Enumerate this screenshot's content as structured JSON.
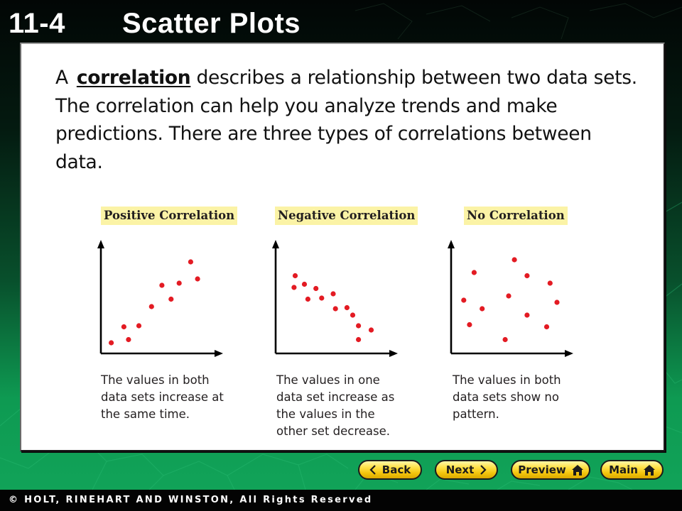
{
  "slide": {
    "lesson_number": "11-4",
    "title": "Scatter Plots"
  },
  "intro": {
    "prefix": "A",
    "term": "correlation",
    "text": " describes a relationship between two data sets. The correlation can help you analyze trends and make predictions. There are three types of correlations between data."
  },
  "correlations": [
    {
      "label": "Positive Correlation",
      "description_lines": [
        "The values in both",
        "data sets increase at",
        "the same time."
      ]
    },
    {
      "label": "Negative Correlation",
      "description_lines": [
        "The values in one",
        "data set increase as",
        "the values in the",
        "other set decrease."
      ]
    },
    {
      "label": "No Correlation",
      "description_lines": [
        "The values in both",
        "data sets show no",
        "pattern."
      ]
    }
  ],
  "navigation": {
    "back_label": "Back",
    "next_label": "Next",
    "preview_label": "Preview",
    "main_label": "Main"
  },
  "footer": {
    "copyright": "© HOLT, RINEHART AND WINSTON, All Rights Reserved"
  },
  "colors": {
    "dot": "#e31b23",
    "label_highlight": "#fbf3a6",
    "button_yellow": "#f6cf1c"
  },
  "chart_data": [
    {
      "type": "scatter",
      "title": "Positive Correlation",
      "xlabel": "",
      "ylabel": "",
      "xlim": [
        0,
        10
      ],
      "ylim": [
        0,
        10
      ],
      "grid": false,
      "points": [
        {
          "x": 0.9,
          "y": 1.0
        },
        {
          "x": 2.0,
          "y": 2.5
        },
        {
          "x": 2.4,
          "y": 1.3
        },
        {
          "x": 3.3,
          "y": 2.6
        },
        {
          "x": 4.4,
          "y": 4.4
        },
        {
          "x": 5.3,
          "y": 6.4
        },
        {
          "x": 6.1,
          "y": 5.1
        },
        {
          "x": 6.8,
          "y": 6.6
        },
        {
          "x": 7.8,
          "y": 8.6
        },
        {
          "x": 8.4,
          "y": 7.0
        }
      ]
    },
    {
      "type": "scatter",
      "title": "Negative Correlation",
      "xlabel": "",
      "ylabel": "",
      "xlim": [
        0,
        10
      ],
      "ylim": [
        0,
        10
      ],
      "grid": false,
      "points": [
        {
          "x": 1.7,
          "y": 7.3
        },
        {
          "x": 1.6,
          "y": 6.2
        },
        {
          "x": 2.5,
          "y": 6.5
        },
        {
          "x": 2.8,
          "y": 5.1
        },
        {
          "x": 3.5,
          "y": 6.1
        },
        {
          "x": 4.0,
          "y": 5.2
        },
        {
          "x": 5.0,
          "y": 5.6
        },
        {
          "x": 5.2,
          "y": 4.2
        },
        {
          "x": 6.2,
          "y": 4.3
        },
        {
          "x": 6.7,
          "y": 3.6
        },
        {
          "x": 7.2,
          "y": 2.6
        },
        {
          "x": 8.3,
          "y": 2.2
        },
        {
          "x": 7.2,
          "y": 1.3
        }
      ]
    },
    {
      "type": "scatter",
      "title": "No Correlation",
      "xlabel": "",
      "ylabel": "",
      "xlim": [
        0,
        10
      ],
      "ylim": [
        0,
        10
      ],
      "grid": false,
      "points": [
        {
          "x": 1.1,
          "y": 5.0
        },
        {
          "x": 1.6,
          "y": 2.7
        },
        {
          "x": 2.0,
          "y": 7.6
        },
        {
          "x": 2.7,
          "y": 4.2
        },
        {
          "x": 4.7,
          "y": 1.3
        },
        {
          "x": 5.0,
          "y": 5.4
        },
        {
          "x": 5.5,
          "y": 8.8
        },
        {
          "x": 6.6,
          "y": 7.3
        },
        {
          "x": 6.6,
          "y": 3.6
        },
        {
          "x": 8.3,
          "y": 2.5
        },
        {
          "x": 8.6,
          "y": 6.6
        },
        {
          "x": 9.2,
          "y": 4.8
        }
      ]
    }
  ]
}
